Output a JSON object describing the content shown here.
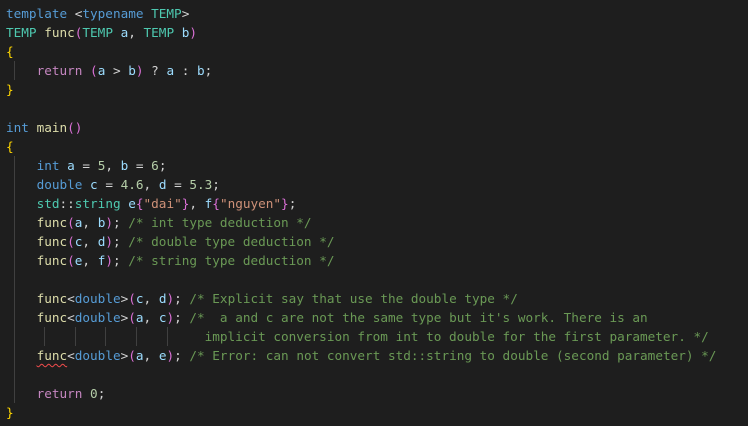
{
  "editor": {
    "lines": [
      "template <typename TEMP>",
      "TEMP func(TEMP a, TEMP b)",
      "{",
      "return (a > b) ? a : b;",
      "}",
      "",
      "int main()",
      "{",
      "int a = 5, b = 6;",
      "double c = 4.6, d = 5.3;",
      "std::string e{\"dai\"}, f{\"nguyen\"};",
      "func(a, b); /* int type deduction */",
      "func(c, d); /* double type deduction */",
      "func(e, f); /* string type deduction */",
      "",
      "func<double>(c, d); /* Explicit say that use the double type */",
      "func<double>(a, c); /*  a and c are not the same type but it's work. There is an",
      "implicit conversion from int to double for the first parameter. */",
      "func<double>(a, e); /* Error: can not convert std::string to double (second parameter) */",
      "",
      "return 0;",
      "}"
    ]
  }
}
